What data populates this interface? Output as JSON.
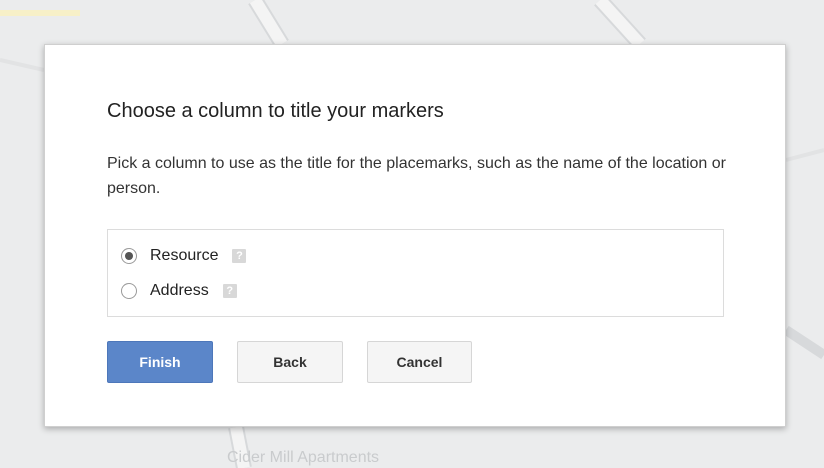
{
  "map": {
    "place_label": "Cider Mill Apartments"
  },
  "dialog": {
    "title": "Choose a column to title your markers",
    "description": "Pick a column to use as the title for the placemarks, such as the name of the location or person.",
    "options": [
      {
        "label": "Resource",
        "checked": true,
        "help_icon": "help-icon"
      },
      {
        "label": "Address",
        "checked": false,
        "help_icon": "help-icon"
      }
    ],
    "buttons": {
      "finish": "Finish",
      "back": "Back",
      "cancel": "Cancel"
    }
  },
  "colors": {
    "primary_button": "#5b86c9",
    "map_background": "#ebeced"
  }
}
